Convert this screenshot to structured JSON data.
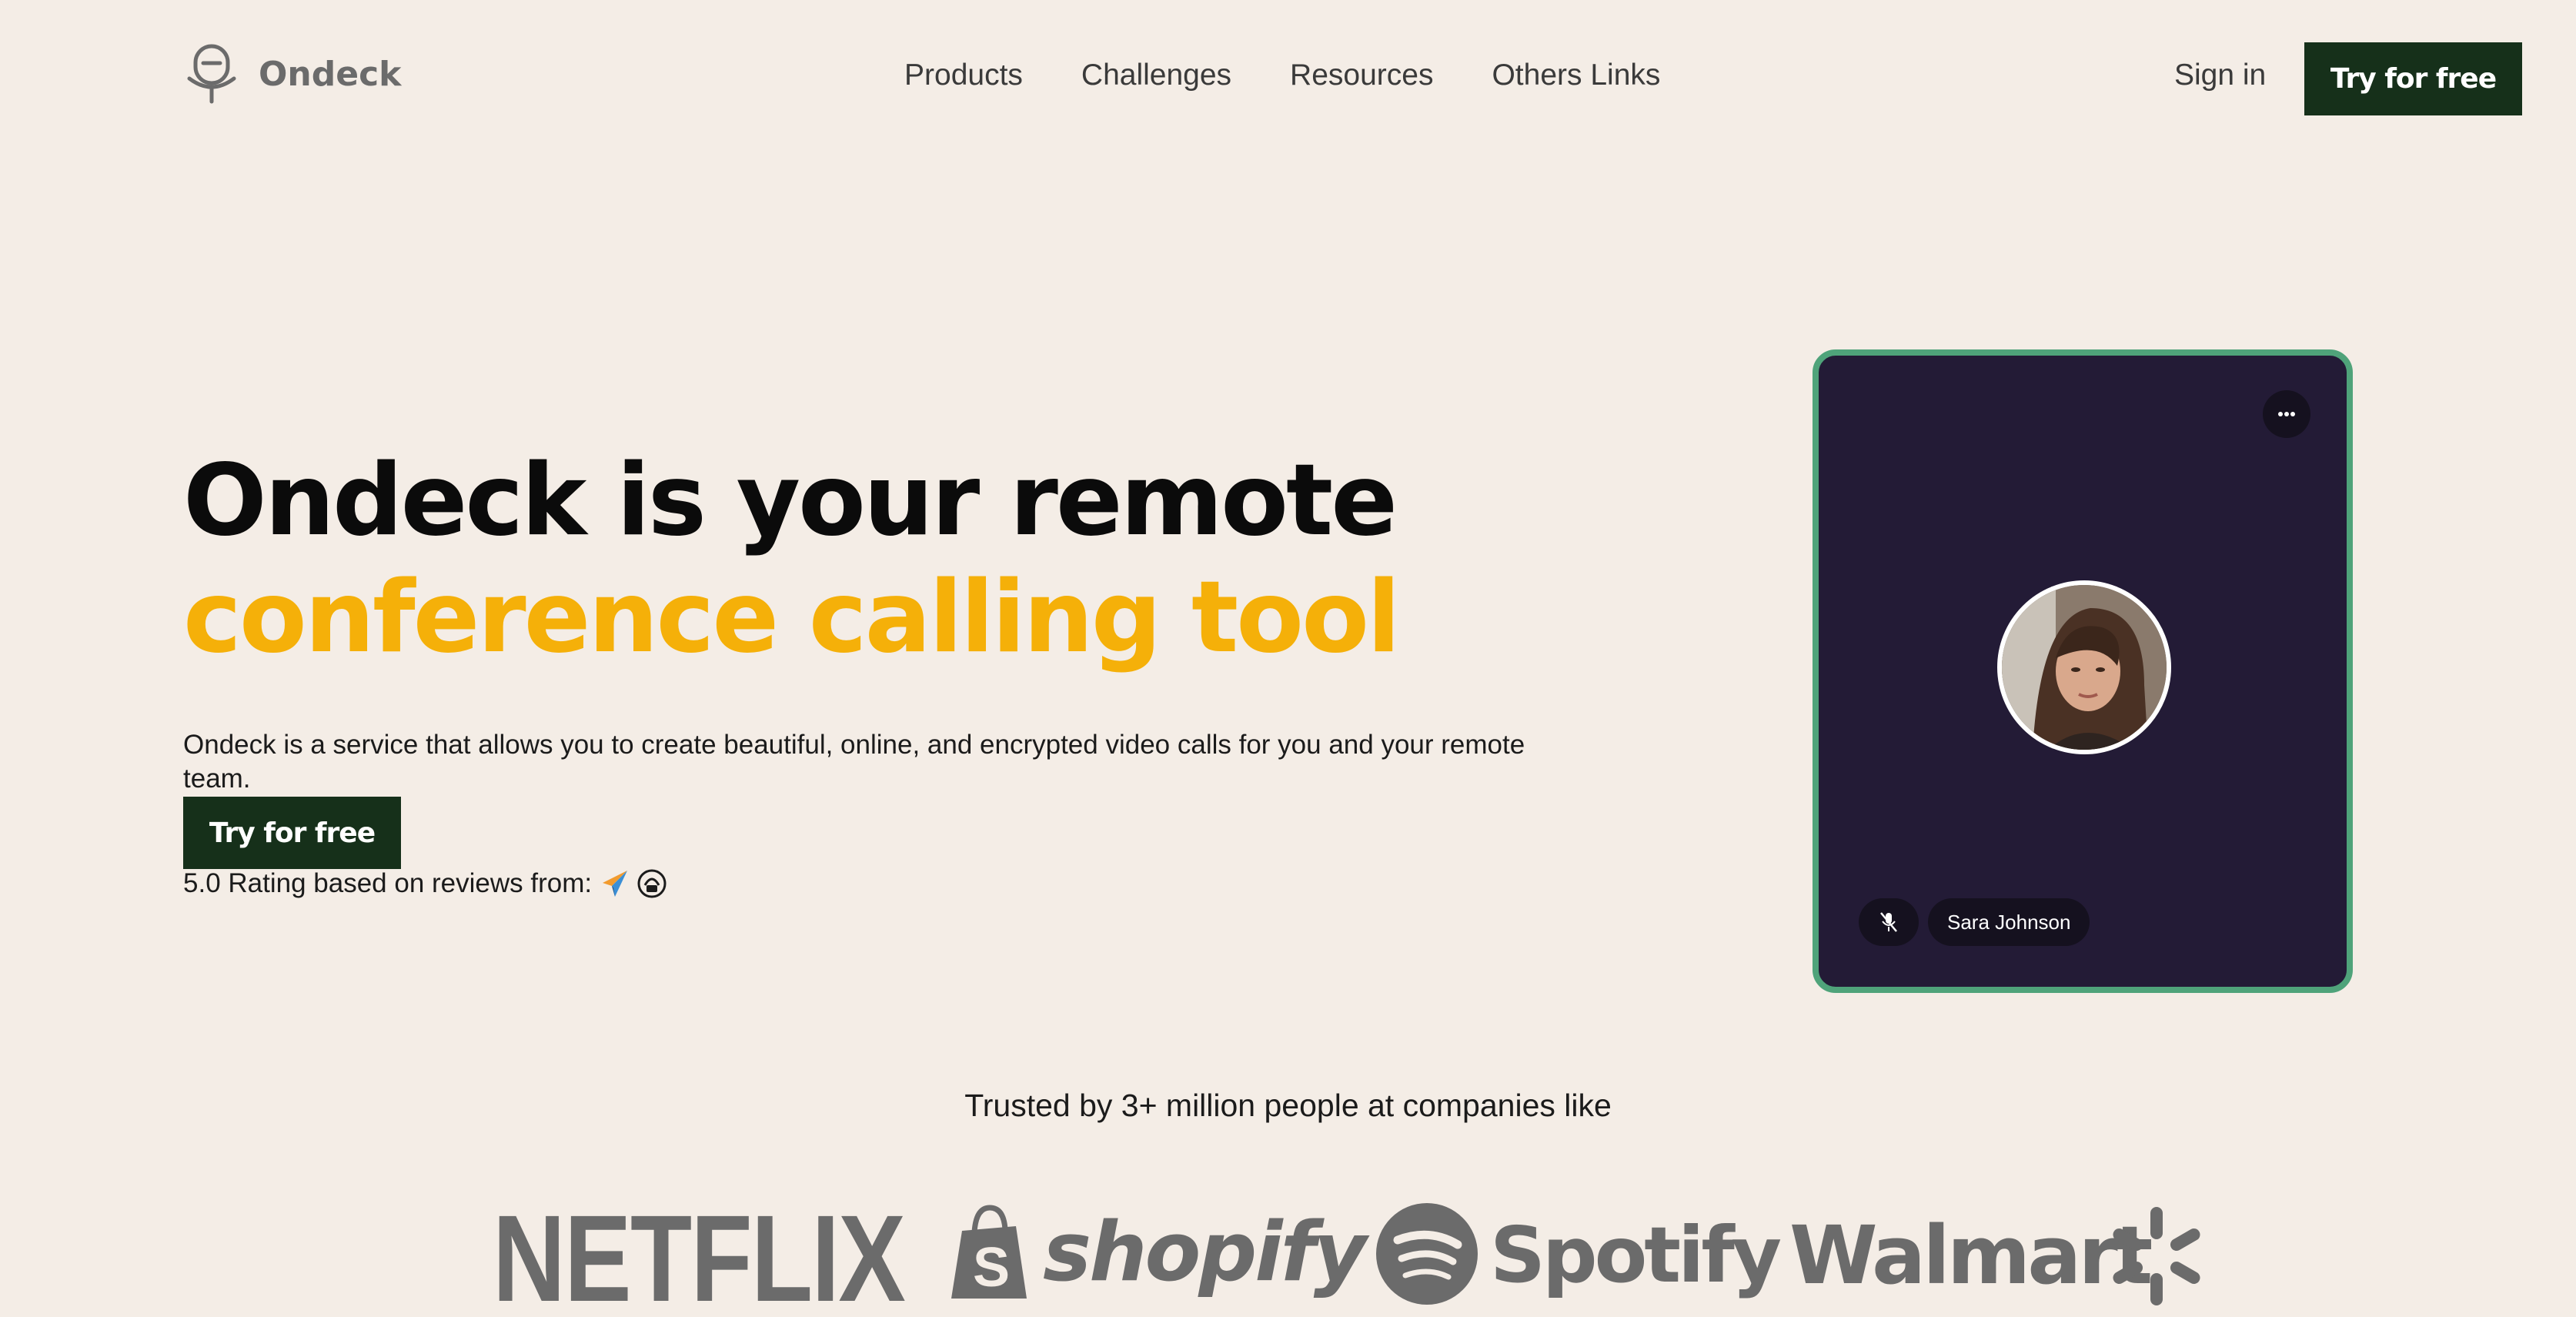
{
  "nav": {
    "brand": "Ondeck",
    "links": [
      "Products",
      "Challenges",
      "Resources",
      "Others Links"
    ],
    "signin": "Sign in",
    "cta": "Try for free"
  },
  "hero": {
    "title_line1": "Ondeck is your remote",
    "title_line2": "conference calling tool",
    "description": "Ondeck is a service that allows you to create beautiful, online, and encrypted video calls for you and your remote team.",
    "cta": "Try for free",
    "rating_text": "5.0 Rating based on reviews from:"
  },
  "call_card": {
    "participant_name": "Sara Johnson",
    "more_icon": "more-horizontal-icon",
    "mute_icon": "mic-off-icon"
  },
  "trusted": {
    "text": "Trusted by 3+ million people at companies like",
    "brands": [
      "NETFLIX",
      "shopify",
      "Spotify",
      "Walmart"
    ]
  },
  "colors": {
    "background": "#f4ede6",
    "dark_green": "#16301a",
    "accent_yellow": "#f5b009",
    "card_bg": "#231b36",
    "card_border": "#4fa37a",
    "logo_gray": "#6b6b6b"
  }
}
